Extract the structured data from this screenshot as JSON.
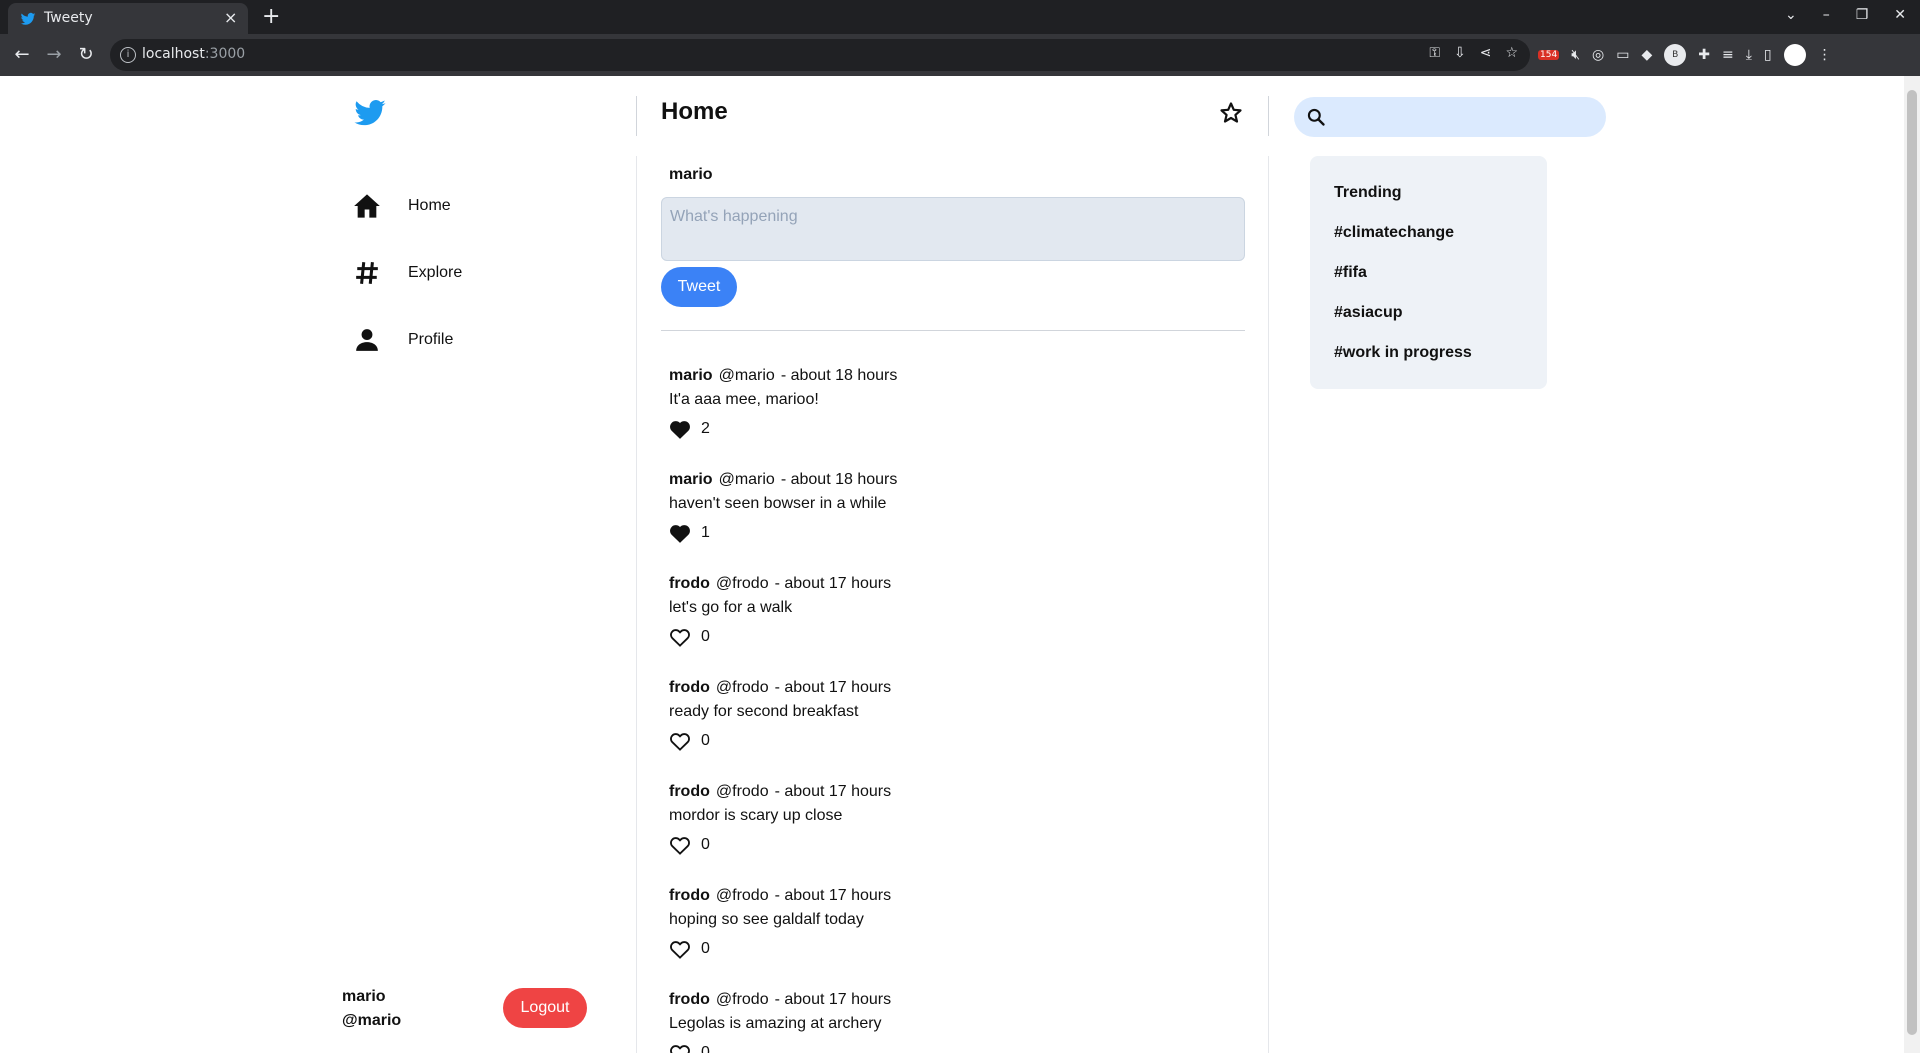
{
  "browser": {
    "tab_title": "Tweety",
    "tab_close": "×",
    "new_tab": "+",
    "url_host": "localhost",
    "url_port": ":3000",
    "ext_badge": "154",
    "profile_initial": "B"
  },
  "sidebar": {
    "items": [
      {
        "label": "Home",
        "icon": "home-icon"
      },
      {
        "label": "Explore",
        "icon": "hashtag-icon"
      },
      {
        "label": "Profile",
        "icon": "person-icon"
      }
    ],
    "user_name": "mario",
    "user_handle": "@mario",
    "logout_label": "Logout"
  },
  "main": {
    "title": "Home",
    "composer": {
      "user": "mario",
      "placeholder": "What's happening",
      "tweet_label": "Tweet"
    },
    "tweets": [
      {
        "name": "mario",
        "handle": "@mario",
        "time": "- about 18 hours",
        "text": "It'a aaa mee, marioo!",
        "likes": "2",
        "liked": true
      },
      {
        "name": "mario",
        "handle": "@mario",
        "time": "- about 18 hours",
        "text": "haven't seen bowser in a while",
        "likes": "1",
        "liked": true
      },
      {
        "name": "frodo",
        "handle": "@frodo",
        "time": "- about 17 hours",
        "text": "let's go for a walk",
        "likes": "0",
        "liked": false
      },
      {
        "name": "frodo",
        "handle": "@frodo",
        "time": "- about 17 hours",
        "text": "ready for second breakfast",
        "likes": "0",
        "liked": false
      },
      {
        "name": "frodo",
        "handle": "@frodo",
        "time": "- about 17 hours",
        "text": "mordor is scary up close",
        "likes": "0",
        "liked": false
      },
      {
        "name": "frodo",
        "handle": "@frodo",
        "time": "- about 17 hours",
        "text": "hoping so see galdalf today",
        "likes": "0",
        "liked": false
      },
      {
        "name": "frodo",
        "handle": "@frodo",
        "time": "- about 17 hours",
        "text": "Legolas is amazing at archery",
        "likes": "0",
        "liked": false
      }
    ]
  },
  "right": {
    "search_placeholder": "",
    "trending": [
      "Trending",
      "#climatechange",
      "#fifa",
      "#asiacup",
      "#work in progress"
    ]
  },
  "colors": {
    "brand": "#1d9bf0",
    "tweet_button": "#3b82f6",
    "logout_button": "#ef4444",
    "search_bg": "#dbeafe",
    "card_bg": "#eef2f7"
  }
}
